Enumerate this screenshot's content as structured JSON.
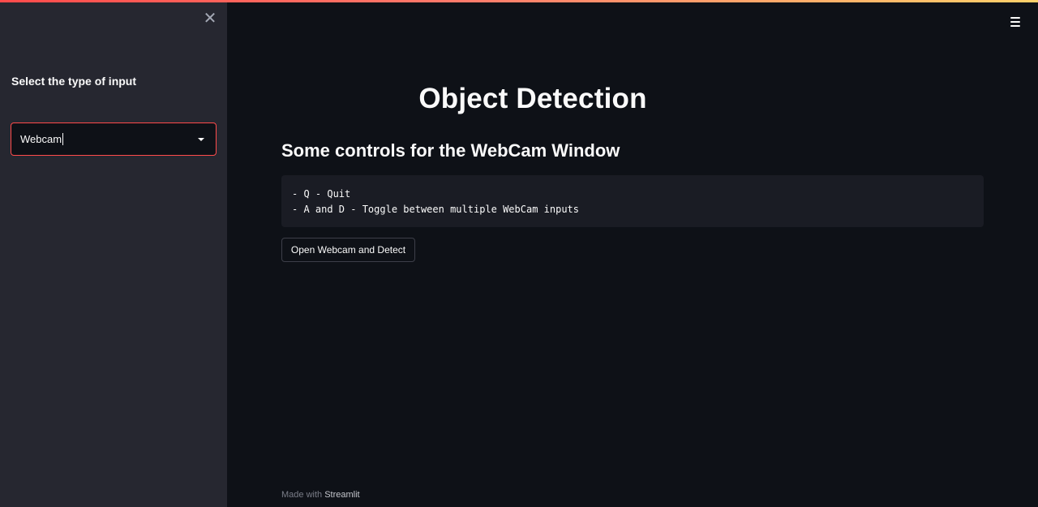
{
  "sidebar": {
    "close_icon": "close-icon",
    "select": {
      "label": "Select the type of input",
      "value": "Webcam"
    }
  },
  "header": {
    "menu_icon": "hamburger-menu-icon"
  },
  "main": {
    "title": "Object Detection",
    "subheader": "Some controls for the WebCam Window",
    "controls": [
      "- Q - Quit",
      "- A and D - Toggle between multiple WebCam inputs"
    ],
    "button_label": "Open Webcam and Detect"
  },
  "footer": {
    "prefix": "Made with",
    "brand": "Streamlit"
  },
  "colors": {
    "primary": "#ff4b4b",
    "background": "#0e1117",
    "sidebar": "#262730",
    "code_background": "#1a1c24"
  }
}
